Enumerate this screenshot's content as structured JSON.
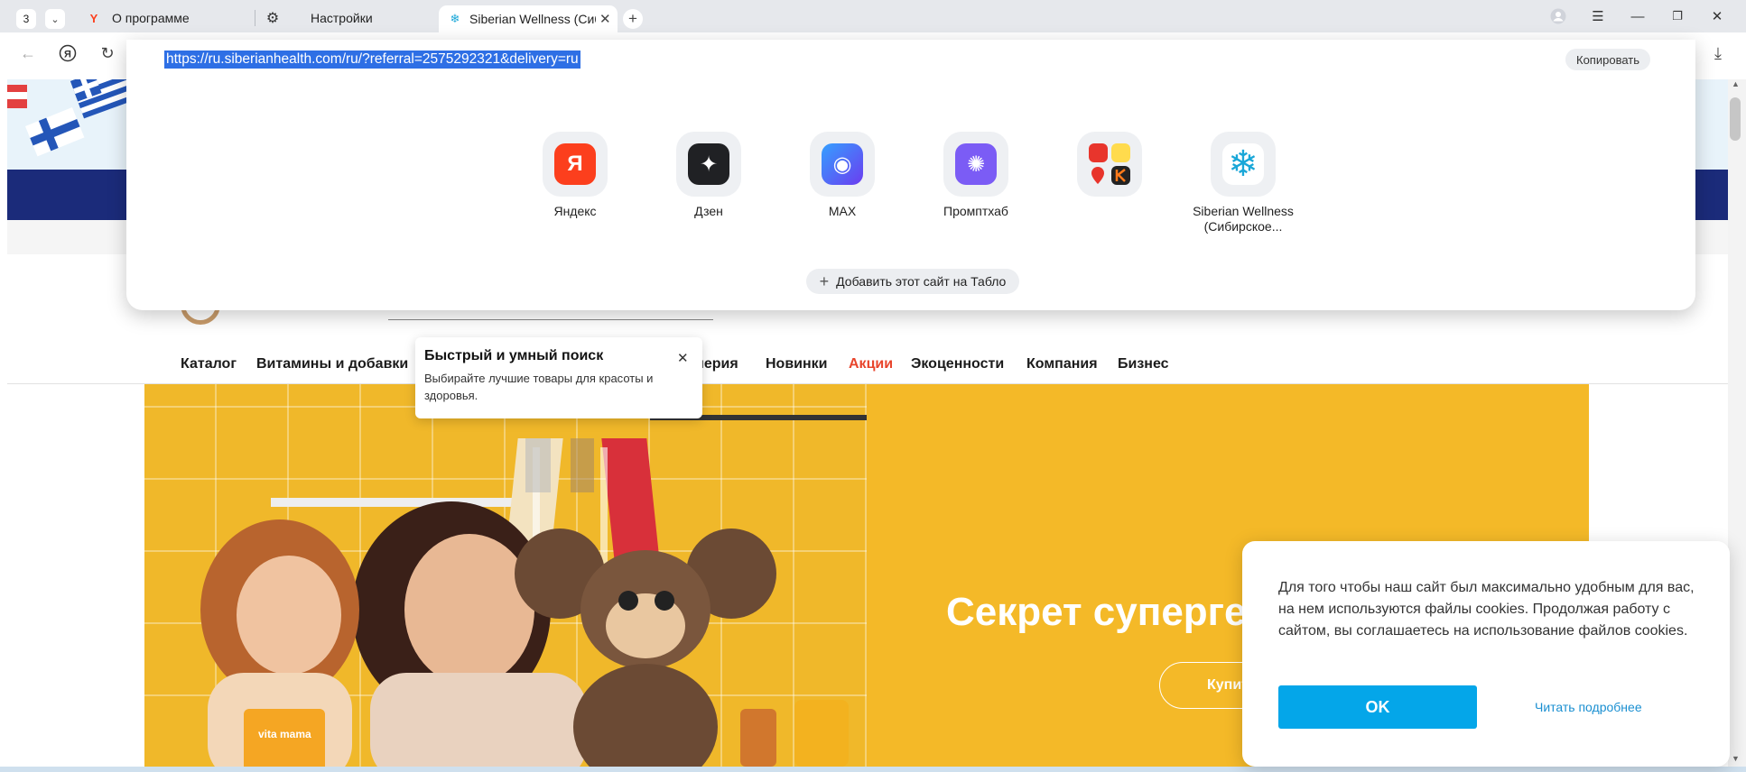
{
  "tabs": {
    "counter": "3",
    "items": [
      {
        "label": "О программе",
        "icon": "yandex-logo-icon"
      },
      {
        "label": "Настройки",
        "icon": "gear-icon"
      },
      {
        "label": "Siberian Wellness (Сиби",
        "icon": "snowflake-icon",
        "active": true
      }
    ],
    "new_tab_glyph": "+"
  },
  "address_bar": {
    "url": "https://ru.siberianhealth.com/ru/?referral=2575292321&delivery=ru",
    "copy_label": "Копировать"
  },
  "speed_dial": {
    "tiles": [
      {
        "label": "Яндекс",
        "glyph": "Я",
        "bg": "#fc3f1d"
      },
      {
        "label": "Дзен",
        "glyph": "✦",
        "bg": "#202124"
      },
      {
        "label": "MAX",
        "glyph": "◉",
        "bg": "#4a58f0"
      },
      {
        "label": "Промптхаб",
        "glyph": "✺",
        "bg": "#7b5cf5"
      },
      {
        "label": "",
        "glyph": "",
        "bg": "#ffffff"
      },
      {
        "label": "Siberian Wellness (Сибирское...",
        "glyph": "❄",
        "bg": "#ffffff"
      }
    ],
    "add_label": "Добавить этот сайт на Табло"
  },
  "site_menu": [
    "Каталог",
    "Витамины и добавки",
    "мерия",
    "Новинки",
    "Акции",
    "Экоценности",
    "Компания",
    "Бизнес"
  ],
  "tooltip": {
    "title": "Быстрый и умный поиск",
    "text": "Выбирайте лучшие товары для красоты и здоровья."
  },
  "hero": {
    "title": "Секрет суперге",
    "button": "Купит",
    "pack_text": "vita mama"
  },
  "cookie": {
    "text": "Для того чтобы наш сайт был максимально удобным для вас, на нем используются файлы cookies. Продолжая работу с сайтом, вы соглашаетесь на использование файлов cookies.",
    "ok_label": "OK",
    "more_label": "Читать подробнее"
  },
  "colors": {
    "accent_promo": "#e8452c",
    "hero_yellow": "#f4b928",
    "cookie_button": "#04a6e9",
    "url_highlight": "#2e6fe5"
  }
}
